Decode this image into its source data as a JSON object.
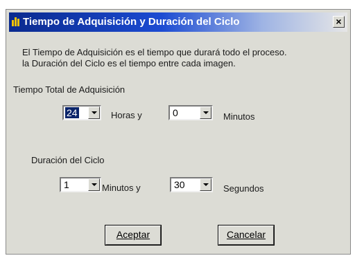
{
  "window": {
    "title": "Tiempo de Adquisición y Duración del Ciclo",
    "close": "×"
  },
  "description": {
    "line1": "El Tiempo de Adquisición es el tiempo que durará todo el proceso.",
    "line2": "la Duración del Ciclo es el tiempo entre cada imagen."
  },
  "total": {
    "label": "Tiempo Total de Adquisición",
    "hours_value": "24",
    "hours_label": "Horas  y",
    "minutes_value": "0",
    "minutes_label": "Minutos"
  },
  "cycle": {
    "label": "Duración del Ciclo",
    "minutes_value": "1",
    "minutes_label": "Minutos  y",
    "seconds_value": "30",
    "seconds_label": "Segundos"
  },
  "buttons": {
    "accept": "Aceptar",
    "cancel": "Cancelar"
  }
}
